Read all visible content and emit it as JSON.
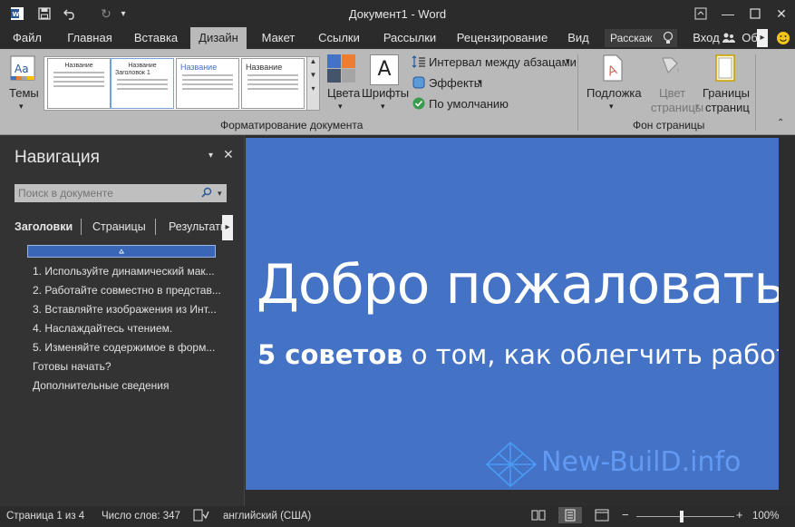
{
  "window": {
    "title": "Документ1 - Word",
    "app_icon": "word-icon",
    "controls": [
      "ribbon-display-icon",
      "minimize-icon",
      "maximize-icon",
      "close-icon"
    ]
  },
  "tabs": {
    "items": [
      "Файл",
      "Главная",
      "Вставка",
      "Дизайн",
      "Макет",
      "Ссылки",
      "Рассылки",
      "Рецензирование",
      "Вид"
    ],
    "active": "Дизайн",
    "tellme": "Расскаж",
    "signin": "Вход",
    "share": "Об"
  },
  "ribbon": {
    "themes_label": "Темы",
    "gallery": [
      {
        "title": "Название",
        "sub": ""
      },
      {
        "title": "Название",
        "sub": "Заголовок 1"
      },
      {
        "title": "Название",
        "sub": ""
      },
      {
        "title": "Название",
        "sub": ""
      }
    ],
    "colors_label": "Цвета",
    "fonts_label": "Шрифты",
    "spacing_label": "Интервал между абзацами",
    "effects_label": "Эффекты",
    "default_label": "По умолчанию",
    "group_format_label": "Форматирование документа",
    "watermark_label": "Подложка",
    "page_color_label_1": "Цвет",
    "page_color_label_2": "страницы",
    "page_borders_label_1": "Границы",
    "page_borders_label_2": "страниц",
    "group_page_bg_label": "Фон страницы",
    "accent_color": "#4472c4"
  },
  "navigation": {
    "title": "Навигация",
    "search_placeholder": "Поиск в документе",
    "tabs": [
      "Заголовки",
      "Страницы",
      "Результать"
    ],
    "active_tab": "Заголовки",
    "headings": [
      "1. Используйте динамический мак...",
      "2. Работайте совместно в представ...",
      "3. Вставляйте изображения из Инт...",
      "4. Наслаждайтесь чтением.",
      "5. Изменяйте содержимое в форм...",
      "Готовы начать?",
      "Дополнительные сведения"
    ]
  },
  "document": {
    "heading": "Добро пожаловать",
    "subtitle_bold": "5 советов",
    "subtitle_rest": " о том, как облегчить работу.",
    "background": "#4472c4",
    "watermark": "New-BuilD.info"
  },
  "status": {
    "page": "Страница 1 из 4",
    "words": "Число слов: 347",
    "language": "английский (США)",
    "zoom": "100%",
    "zoom_level": 1.0
  }
}
